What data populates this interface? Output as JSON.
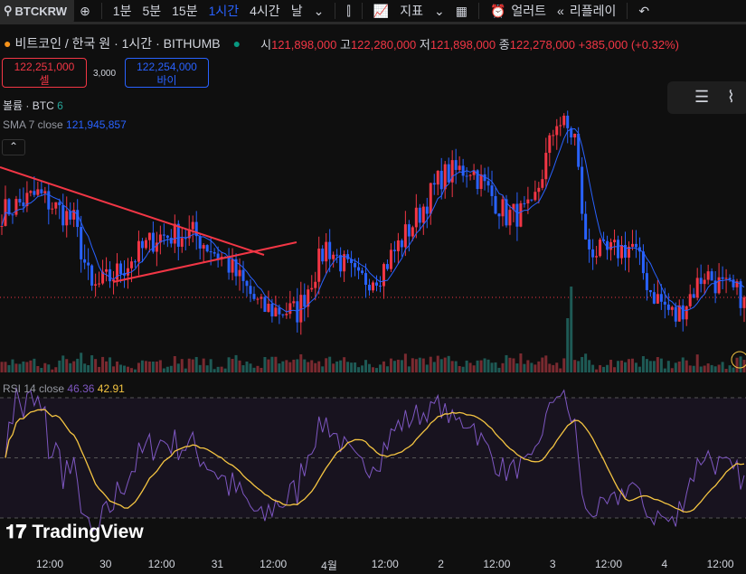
{
  "toolbar": {
    "symbol": "BTCKRW",
    "intervals": [
      "1분",
      "5분",
      "15분",
      "1시간",
      "4시간",
      "날"
    ],
    "active_interval": "1시간",
    "indicators": "지표",
    "alert": "얼러트",
    "replay": "리플레이"
  },
  "legend": {
    "title": "비트코인 / 한국 원 · 1시간 · BITHUMB",
    "o_label": "시",
    "o": "121,898,000",
    "h_label": "고",
    "h": "122,280,000",
    "l_label": "저",
    "l": "121,898,000",
    "c_label": "종",
    "c": "122,278,000",
    "change": "+385,000 (+0.32%)"
  },
  "sell": {
    "price": "122,251,000",
    "label": "셀"
  },
  "spread": "3,000",
  "buy": {
    "price": "122,254,000",
    "label": "바이"
  },
  "volume": {
    "label": "볼륨 · BTC",
    "value": "6"
  },
  "sma": {
    "label": "SMA 7 close",
    "value": "121,945,857"
  },
  "rsi": {
    "label": "RSI 14 close",
    "value": "46.36",
    "ma": "42.91"
  },
  "logo": "TradingView",
  "colors": {
    "up": "#f23645",
    "down": "#2962ff",
    "sma": "#2962ff",
    "rsi": "#7e57c2",
    "rsi_ma": "#f5c542"
  },
  "chart_data": {
    "type": "candlestick",
    "unit": "million KRW",
    "last_price": 122.278,
    "close_keypoints": [
      [
        0,
        125.1
      ],
      [
        10,
        125.7
      ],
      [
        20,
        124.8
      ],
      [
        25,
        122.5
      ],
      [
        32,
        123.1
      ],
      [
        43,
        124.3
      ],
      [
        53,
        124.4
      ],
      [
        62,
        123.5
      ],
      [
        72,
        121.9
      ],
      [
        82,
        121.8
      ],
      [
        90,
        124.0
      ],
      [
        99,
        122.8
      ],
      [
        105,
        123.1
      ],
      [
        115,
        124.9
      ],
      [
        122,
        126.3
      ],
      [
        130,
        126.6
      ],
      [
        140,
        125.0
      ],
      [
        147,
        125.1
      ],
      [
        154,
        128.2
      ],
      [
        159,
        127.6
      ],
      [
        162,
        124.0
      ],
      [
        167,
        123.7
      ],
      [
        175,
        124.0
      ],
      [
        180,
        122.5
      ],
      [
        187,
        121.6
      ],
      [
        195,
        123.1
      ],
      [
        200,
        122.6
      ],
      [
        206,
        122.3
      ]
    ],
    "x_labels": [
      "12:00",
      "30",
      "12:00",
      "31",
      "12:00",
      "4월",
      "12:00",
      "2",
      "12:00",
      "3",
      "12:00",
      "4",
      "12:00"
    ],
    "rsi_levels": [
      70,
      50,
      30
    ]
  }
}
